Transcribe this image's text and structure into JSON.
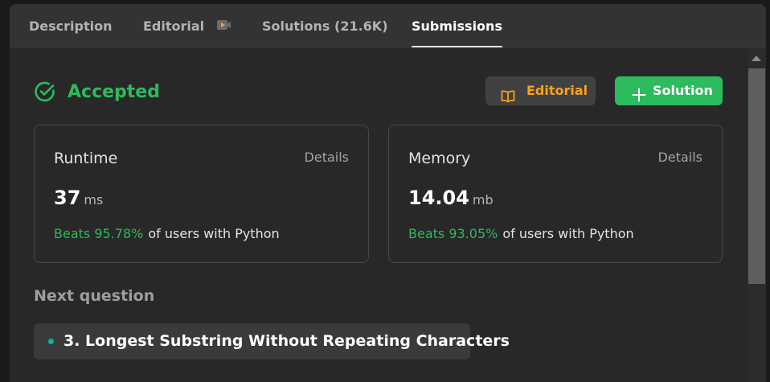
{
  "tabs": [
    {
      "label": "Description"
    },
    {
      "label": "Editorial",
      "icon": "video-icon"
    },
    {
      "label": "Solutions (21.6K)"
    },
    {
      "label": "Submissions",
      "active": true
    }
  ],
  "status": {
    "text": "Accepted",
    "icon": "check-circle-icon",
    "color": "#2cbb5d"
  },
  "buttons": {
    "editorial": {
      "label": "Editorial",
      "icon": "book-icon"
    },
    "solution": {
      "label": "Solution",
      "icon": "plus-icon"
    }
  },
  "runtime": {
    "title": "Runtime",
    "details": "Details",
    "value": "37",
    "unit": "ms",
    "beats": "Beats 95.78%",
    "rest": "of users with Python"
  },
  "memory": {
    "title": "Memory",
    "details": "Details",
    "value": "14.04",
    "unit": "mb",
    "beats": "Beats 93.05%",
    "rest": "of users with Python"
  },
  "next": {
    "label": "Next question",
    "title": "3. Longest Substring Without Repeating Characters"
  },
  "colors": {
    "accent_green": "#2cbb5d",
    "accent_orange": "#ffa116",
    "teal": "#00b8a3"
  }
}
